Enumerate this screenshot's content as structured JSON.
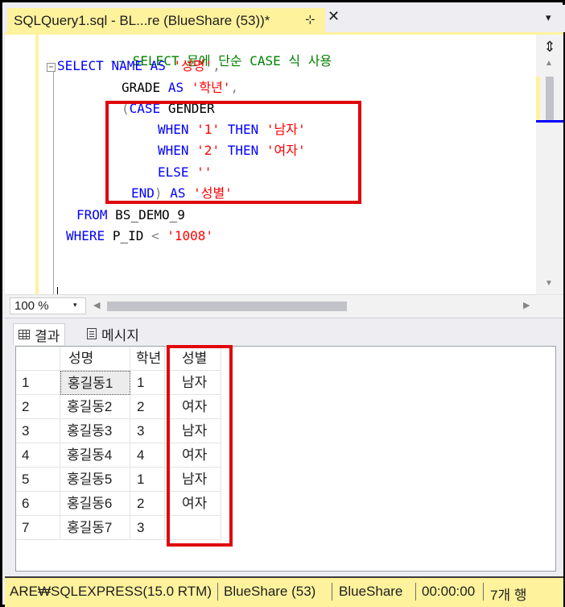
{
  "tab": {
    "title": "SQLQuery1.sql - BL...re (BlueShare (53))*",
    "pin_glyph": "⊹",
    "close_glyph": "✕",
    "overflow_glyph": "▾"
  },
  "editor": {
    "comment": "-- SELECT 문에 단순 CASE 식 사용",
    "l2_kw1": "SELECT",
    "l2_id1": "NAME",
    "l2_kw2": "AS",
    "l2_str": "'성명'",
    "l2_op": ",",
    "l3_id": "GRADE",
    "l3_kw": "AS",
    "l3_str": "'학년'",
    "l3_op": ",",
    "l4_paren": "(",
    "l4_kw": "CASE",
    "l4_id": "GENDER",
    "l5_kw1": "WHEN",
    "l5_str1": "'1'",
    "l5_kw2": "THEN",
    "l5_str2": "'남자'",
    "l6_kw1": "WHEN",
    "l6_str1": "'2'",
    "l6_kw2": "THEN",
    "l6_str2": "'여자'",
    "l7_kw": "ELSE",
    "l7_str": "''",
    "l8_kw1": "END",
    "l8_paren": ")",
    "l8_kw2": "AS",
    "l8_str": "'성별'",
    "l9_kw": "FROM",
    "l9_id": "BS_DEMO_9",
    "l10_kw": "WHERE",
    "l10_id": "P_ID",
    "l10_op": "<",
    "l10_str": "'1008'",
    "collapse_glyph": "−"
  },
  "zoom": {
    "value": "100 %",
    "arrow": "▾"
  },
  "results_tabs": {
    "results_label": "결과",
    "messages_label": "메시지"
  },
  "grid": {
    "columns": [
      "성명",
      "학년",
      "성별"
    ],
    "rows": [
      {
        "num": "1",
        "name": "홍길동1",
        "grade": "1",
        "gender": "남자"
      },
      {
        "num": "2",
        "name": "홍길동2",
        "grade": "2",
        "gender": "여자"
      },
      {
        "num": "3",
        "name": "홍길동3",
        "grade": "3",
        "gender": "남자"
      },
      {
        "num": "4",
        "name": "홍길동4",
        "grade": "4",
        "gender": "여자"
      },
      {
        "num": "5",
        "name": "홍길동5",
        "grade": "1",
        "gender": "남자"
      },
      {
        "num": "6",
        "name": "홍길동6",
        "grade": "2",
        "gender": "여자"
      },
      {
        "num": "7",
        "name": "홍길동7",
        "grade": "3",
        "gender": ""
      }
    ]
  },
  "status": {
    "server": "ARE₩SQLEXPRESS(15.0 RTM)",
    "connection": "BlueShare (53)",
    "database": "BlueShare",
    "elapsed": "00:00:00",
    "rows": "7개 행"
  },
  "colors": {
    "tab_accent": "#fff29d",
    "highlight_box": "#e0070c",
    "keyword": "#0000ff",
    "string": "#ff0000",
    "comment": "#008000"
  }
}
